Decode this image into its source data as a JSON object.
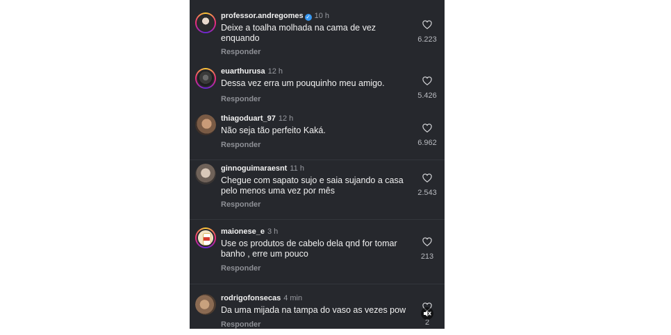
{
  "comments": [
    {
      "username": "professor.andregomes",
      "verified": true,
      "time": "10 h",
      "text": "Deixe a toalha molhada na cama de vez enquando",
      "reply": "Responder",
      "likes": "6.223",
      "avatar": "avatar-professor"
    },
    {
      "username": "euarthurusa",
      "verified": false,
      "time": "12 h",
      "text": "Dessa vez erra um pouquinho meu amigo.",
      "reply": "Responder",
      "likes": "5.426",
      "avatar": "avatar-euarthurusa"
    },
    {
      "username": "thiagoduart_97",
      "verified": false,
      "time": "12 h",
      "text": "Não seja tão perfeito Kaká.",
      "reply": "Responder",
      "likes": "6.962",
      "avatar": "avatar-thiago"
    },
    {
      "username": "ginnoguimaraesnt",
      "verified": false,
      "time": "11 h",
      "text": "Chegue com sapato sujo e saia sujando a casa pelo menos uma vez por mês",
      "reply": "Responder",
      "likes": "2.543",
      "avatar": "avatar-ginno"
    },
    {
      "username": "maionese_e",
      "verified": false,
      "time": "3 h",
      "text": "Use os produtos de cabelo dela qnd for tomar banho , erre um pouco",
      "reply": "Responder",
      "likes": "213",
      "avatar": "avatar-maionese"
    },
    {
      "username": "rodrigofonsecas",
      "verified": false,
      "time": "4 min",
      "text": "Da uma mijada na tampa do vaso as vezes pow",
      "reply": "Responder",
      "likes": "2",
      "avatar": "avatar-rodrigo"
    }
  ],
  "icons": {
    "like": "heart-outline-icon",
    "verified": "verified-badge-icon",
    "mute": "speaker-muted-icon"
  },
  "colors": {
    "background": "#26282d",
    "text": "#f2f2f2",
    "secondary": "#9a9ca2",
    "verified": "#3897f0"
  }
}
